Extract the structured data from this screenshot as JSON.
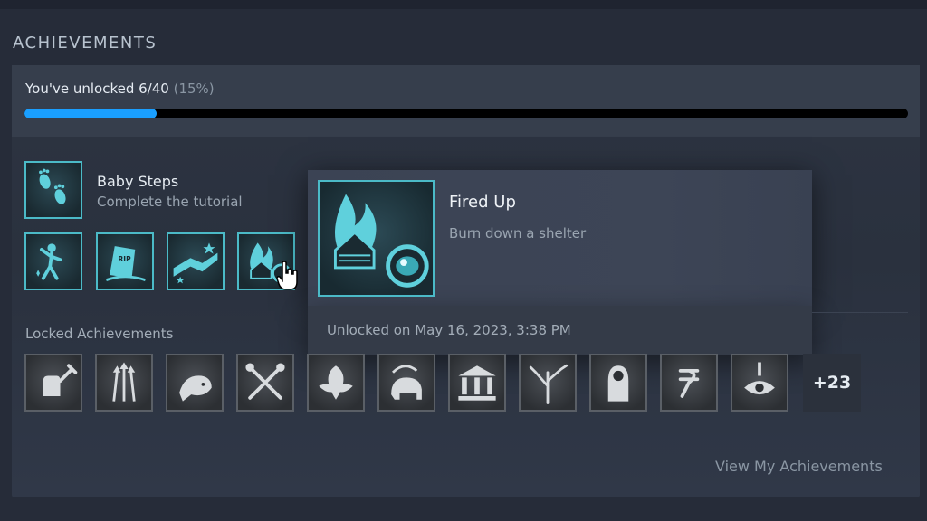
{
  "section": {
    "title": "ACHIEVEMENTS"
  },
  "progress": {
    "text": "You've unlocked 6/40",
    "percent_text": "(15%)",
    "fraction": 0.15
  },
  "featured": {
    "title": "Baby Steps",
    "description": "Complete the tutorial",
    "icon": "footprints-icon"
  },
  "unlocked_icons": [
    {
      "icon": "dancing-figure-icon"
    },
    {
      "icon": "rip-tombstone-icon"
    },
    {
      "icon": "handshake-stars-icon"
    },
    {
      "icon": "burning-shelter-icon"
    }
  ],
  "tooltip": {
    "title": "Fired Up",
    "description": "Burn down a shelter",
    "unlocked_on": "Unlocked on May 16, 2023, 3:38 PM",
    "icon": "burning-shelter-icon"
  },
  "locked": {
    "label": "Locked Achievements",
    "icons": [
      "wrench-fist-icon",
      "arrows-icon",
      "fish-icon",
      "crossed-tools-icon",
      "leaf-icon",
      "mammoth-icon",
      "temple-icon",
      "branches-icon",
      "hooded-figure-icon",
      "rune-icon",
      "eye-dagger-icon"
    ],
    "more_count": "+23"
  },
  "footer": {
    "view_link": "View My Achievements"
  },
  "colors": {
    "accent_blue": "#1a9fff",
    "unlocked_cyan": "#4bbac7",
    "background": "#262c39"
  }
}
